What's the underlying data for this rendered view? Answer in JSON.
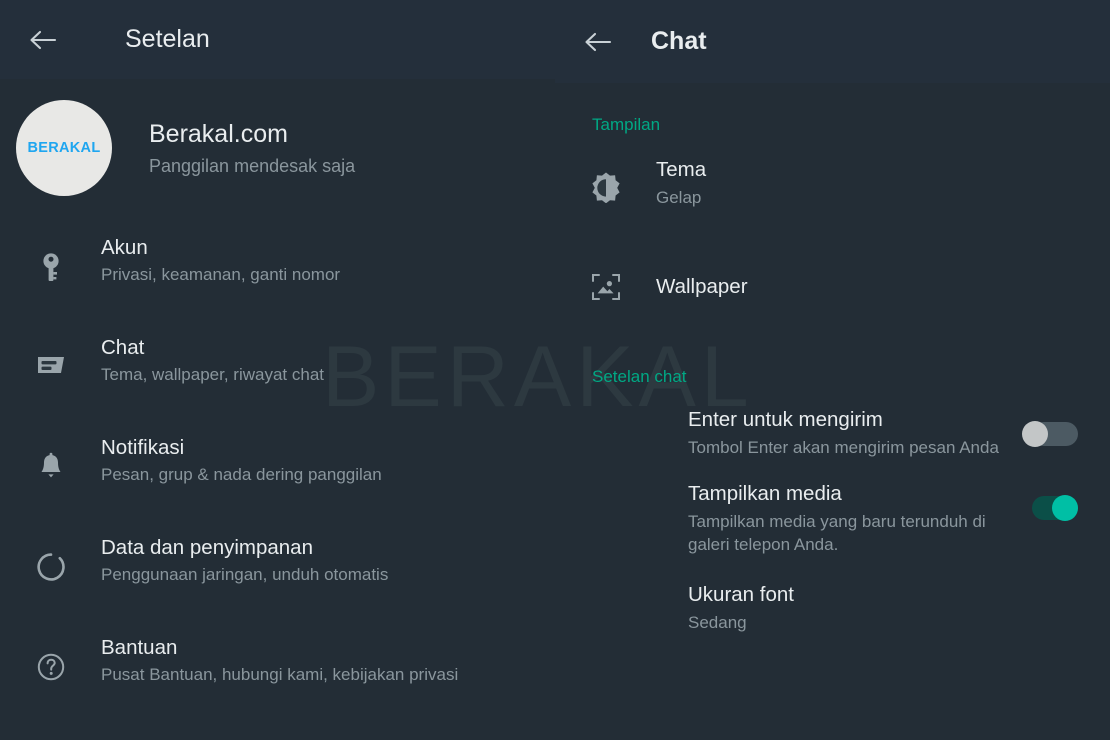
{
  "left_pane": {
    "header": {
      "back_icon": "back-arrow-icon",
      "title": "Setelan"
    },
    "profile": {
      "avatar_text": "BERAKAL",
      "avatar_bg": "#e8e8e6",
      "avatar_text_color": "#1fa6f0",
      "name": "Berakal.com",
      "status": "Panggilan mendesak saja"
    },
    "items": [
      {
        "icon": "key-icon",
        "title": "Akun",
        "subtitle": "Privasi, keamanan, ganti nomor"
      },
      {
        "icon": "chat-bubble-icon",
        "title": "Chat",
        "subtitle": "Tema, wallpaper, riwayat chat"
      },
      {
        "icon": "bell-icon",
        "title": "Notifikasi",
        "subtitle": "Pesan, grup & nada dering panggilan"
      },
      {
        "icon": "data-storage-icon",
        "title": "Data dan penyimpanan",
        "subtitle": "Penggunaan jaringan, unduh otomatis"
      },
      {
        "icon": "help-circle-icon",
        "title": "Bantuan",
        "subtitle": "Pusat Bantuan, hubungi kami, kebijakan privasi"
      }
    ]
  },
  "right_pane": {
    "header": {
      "back_icon": "back-arrow-icon",
      "title": "Chat"
    },
    "sections": [
      {
        "label": "Tampilan",
        "label_color": "#00a884"
      },
      {
        "label": "Setelan chat",
        "label_color": "#00a884"
      }
    ],
    "tema": {
      "icon": "brightness-icon",
      "title": "Tema",
      "value": "Gelap"
    },
    "wallpaper": {
      "icon": "image-frame-icon",
      "title": "Wallpaper"
    },
    "enter_to_send": {
      "title": "Enter untuk mengirim",
      "subtitle": "Tombol Enter akan mengirim pesan Anda",
      "toggle_state": "off"
    },
    "show_media": {
      "title": "Tampilkan media",
      "subtitle": "Tampilkan media yang baru terunduh di galeri telepon Anda.",
      "toggle_state": "on"
    },
    "font_size": {
      "title": "Ukuran font",
      "value": "Sedang"
    }
  },
  "watermark": {
    "text": "BERAKAL",
    "color": "#2d3940"
  },
  "theme": {
    "background": "#232d36",
    "topbar": "#242f3b",
    "accent": "#00a884",
    "primary_text": "#e9edef",
    "secondary_text": "#8a969d",
    "toggle_on_knob": "#00bfa5",
    "toggle_on_track": "#0b4f48",
    "toggle_off_knob": "#c3c6c7",
    "toggle_off_track": "#4c5a63"
  }
}
